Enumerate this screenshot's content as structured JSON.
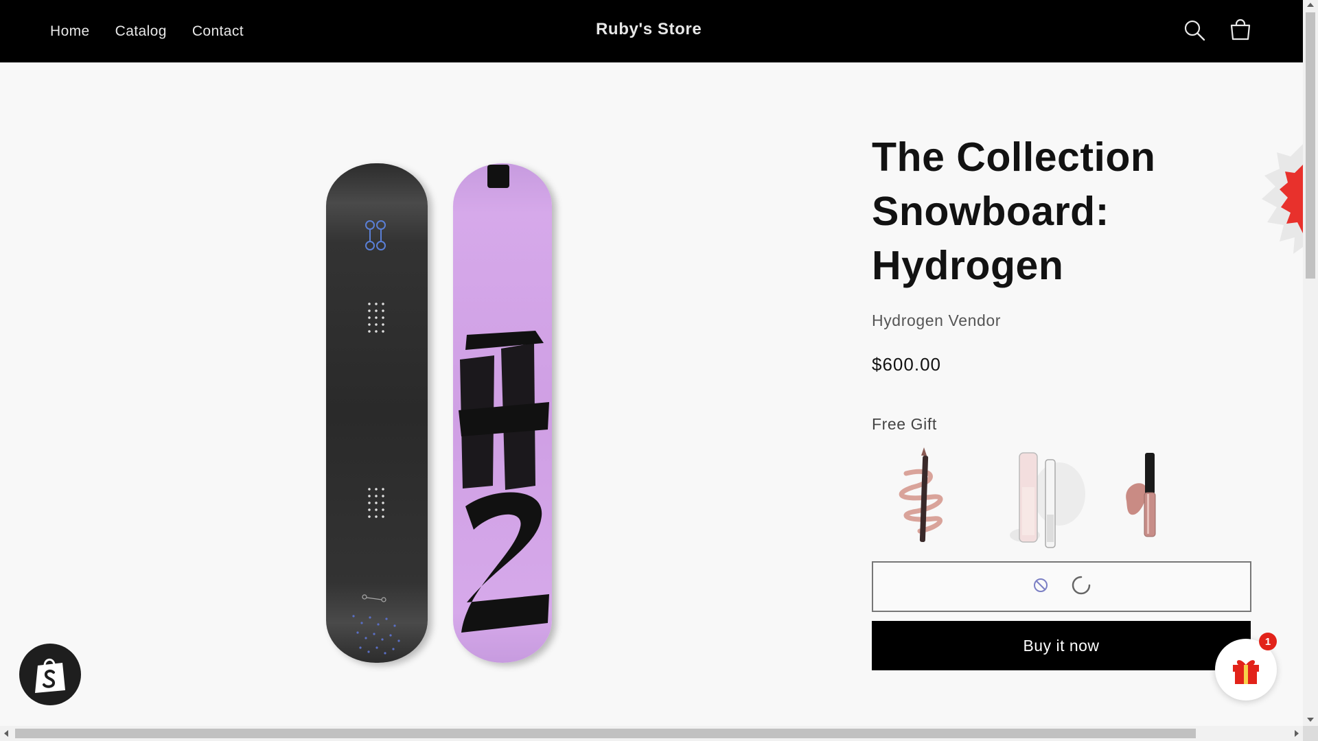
{
  "header": {
    "nav": [
      "Home",
      "Catalog",
      "Contact"
    ],
    "brand": "Ruby's Store",
    "search_icon": "search-icon",
    "cart_icon": "cart-icon"
  },
  "product": {
    "title": "The Collection Snowboard: Hydrogen",
    "vendor": "Hydrogen Vendor",
    "price": "$600.00",
    "gift_label": "Free Gift",
    "gift_items": [
      "lip-liner-pencil",
      "lip-plumper-gloss",
      "liquid-lipstick"
    ],
    "add_to_cart_state": "loading",
    "buy_now_label": "Buy it now"
  },
  "floating": {
    "shopify_badge_icon": "shopify-bag-icon",
    "gift_widget_icon": "gift-box-icon",
    "gift_count": "1"
  },
  "colors": {
    "header_bg": "#000000",
    "buy_button_bg": "#000000",
    "board_purple": "#d3a6e8",
    "gift_red": "#e2231a"
  }
}
